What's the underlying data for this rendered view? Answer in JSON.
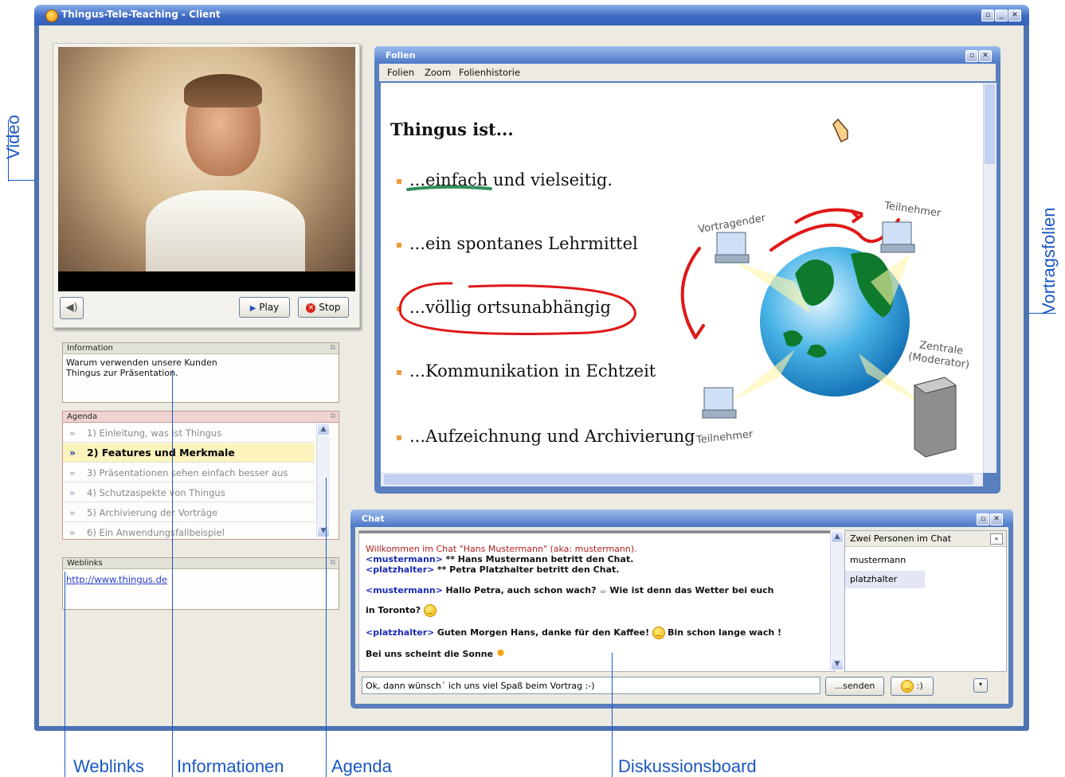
{
  "window": {
    "title": "Thingus-Tele-Teaching - Client",
    "controls": [
      "restore-icon",
      "minimize-icon",
      "close-icon"
    ]
  },
  "video": {
    "play_label": "Play",
    "stop_label": "Stop"
  },
  "information": {
    "header": "Information",
    "text": "Warum verwenden unsere Kunden\nThingus zur Präsentation."
  },
  "agenda": {
    "header": "Agenda",
    "items": [
      {
        "label": "1) Einleitung, was ist Thingus",
        "active": false
      },
      {
        "label": "2) Features und Merkmale",
        "active": true
      },
      {
        "label": "3) Präsentationen sehen einfach besser aus",
        "active": false
      },
      {
        "label": "4) Schutzaspekte von Thingus",
        "active": false
      },
      {
        "label": "5) Archivierung der Vorträge",
        "active": false
      },
      {
        "label": "6) Ein Anwendungsfallbeispiel",
        "active": false
      }
    ]
  },
  "weblinks": {
    "header": "Weblinks",
    "link": "http://www.thingus.de"
  },
  "slides": {
    "title": "Folien",
    "menu": [
      "Folien",
      "Zoom",
      "Folienhistorie"
    ],
    "slide_title": "Thingus ist...",
    "bullets": [
      "...einfach und vielseitig.",
      "...ein spontanes Lehrmittel",
      "...völlig ortsunabhängig",
      "...Kommunikation in Echtzeit",
      "...Aufzeichnung und Archivierung"
    ],
    "diagram_labels": {
      "presenter": "Vortragender",
      "participant_top": "Teilnehmer",
      "participant_bottom": "Teilnehmer",
      "central": "Zentrale",
      "moderator": "(Moderator)"
    }
  },
  "chat": {
    "title": "Chat",
    "messages": {
      "welcome": "Willkommen im Chat \"Hans Mustermann\" (aka: mustermann).",
      "m1_nick": "<mustermann>",
      "m1_text": "** Hans Mustermann betritt den Chat.",
      "m2_nick": "<platzhalter>",
      "m2_text": "** Petra Platzhalter betritt den Chat.",
      "m3_nick": "<mustermann>",
      "m3_text_a": "Hallo Petra, auch schon wach?",
      "m3_text_b": "Wie ist denn das Wetter bei euch",
      "m3_text_c": "in Toronto?",
      "m4_nick": "<platzhalter>",
      "m4_text_a": "Guten Morgen Hans, danke für den Kaffee!",
      "m4_text_b": "Bin schon lange wach !",
      "m4_text_c": "Bei uns scheint die Sonne"
    },
    "users_header": "Zwei Personen im Chat",
    "users": [
      "mustermann",
      "platzhalter"
    ],
    "input_value": "Ok, dann wünsch´ ich uns viel Spaß beim Vortrag :-)",
    "send_label": "...senden",
    "smiley_label": ":)"
  },
  "annotations": {
    "video": "Video",
    "slides": "Vortragsfolien",
    "weblinks": "Weblinks",
    "information": "Informationen",
    "agenda": "Agenda",
    "board": "Diskussionsboard"
  },
  "colors": {
    "annotation": "#1b57c4",
    "titlebar": "#3d69c3",
    "agenda_active": "#fcf3bd",
    "bullet": "#f29a3a"
  }
}
